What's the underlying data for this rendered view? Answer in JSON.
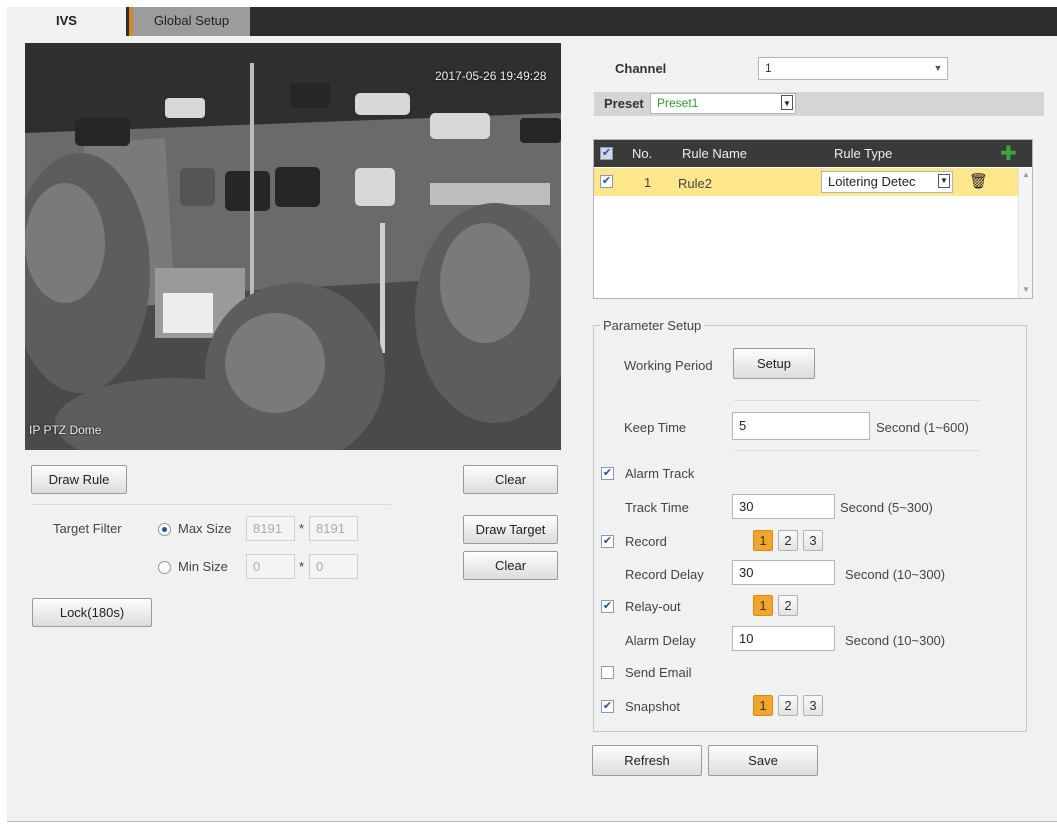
{
  "tabs": [
    {
      "label": "IVS",
      "active": true
    },
    {
      "label": "Global Setup",
      "active": false
    }
  ],
  "video": {
    "timestamp": "2017-05-26 19:49:28",
    "channel_name": "IP PTZ Dome"
  },
  "left_controls": {
    "draw_rule": "Draw Rule",
    "clear_rule": "Clear",
    "target_filter_label": "Target Filter",
    "max_size_label": "Max Size",
    "max_w": "8191",
    "max_h": "8191",
    "min_size_label": "Min Size",
    "min_w": "0",
    "min_h": "0",
    "times": "*",
    "draw_target": "Draw Target",
    "clear_target": "Clear",
    "lock": "Lock(180s)"
  },
  "channel": {
    "label": "Channel",
    "value": "1"
  },
  "preset": {
    "label": "Preset",
    "value": "Preset1"
  },
  "rules": {
    "headers": {
      "no": "No.",
      "name": "Rule Name",
      "type": "Rule Type"
    },
    "rows": [
      {
        "checked": true,
        "no": "1",
        "name": "Rule2",
        "type": "Loitering Detec"
      }
    ]
  },
  "params": {
    "legend": "Parameter Setup",
    "working_period_label": "Working Period",
    "setup_button": "Setup",
    "keep_time_label": "Keep Time",
    "keep_time_value": "5",
    "keep_time_unit": "Second (1~600)",
    "alarm_track_label": "Alarm Track",
    "alarm_track_checked": true,
    "track_time_label": "Track Time",
    "track_time_value": "30",
    "track_time_unit": "Second (5~300)",
    "record_label": "Record",
    "record_checked": true,
    "record_channels": [
      "1",
      "2",
      "3"
    ],
    "record_delay_label": "Record Delay",
    "record_delay_value": "30",
    "record_delay_unit": "Second (10~300)",
    "relay_out_label": "Relay-out",
    "relay_out_checked": true,
    "relay_channels": [
      "1",
      "2"
    ],
    "alarm_delay_label": "Alarm Delay",
    "alarm_delay_value": "10",
    "alarm_delay_unit": "Second (10~300)",
    "send_email_label": "Send Email",
    "send_email_checked": false,
    "snapshot_label": "Snapshot",
    "snapshot_checked": true,
    "snapshot_channels": [
      "1",
      "2",
      "3"
    ]
  },
  "footer": {
    "refresh": "Refresh",
    "save": "Save"
  },
  "icons": {
    "add": "plus-icon",
    "delete": "trash-icon",
    "dropdown": "chevron-down-icon"
  },
  "colors": {
    "accent": "#f2a52d",
    "highlight_row": "#fde68c",
    "add_icon": "#3aa53a",
    "preset_text": "#2e9e2e"
  }
}
